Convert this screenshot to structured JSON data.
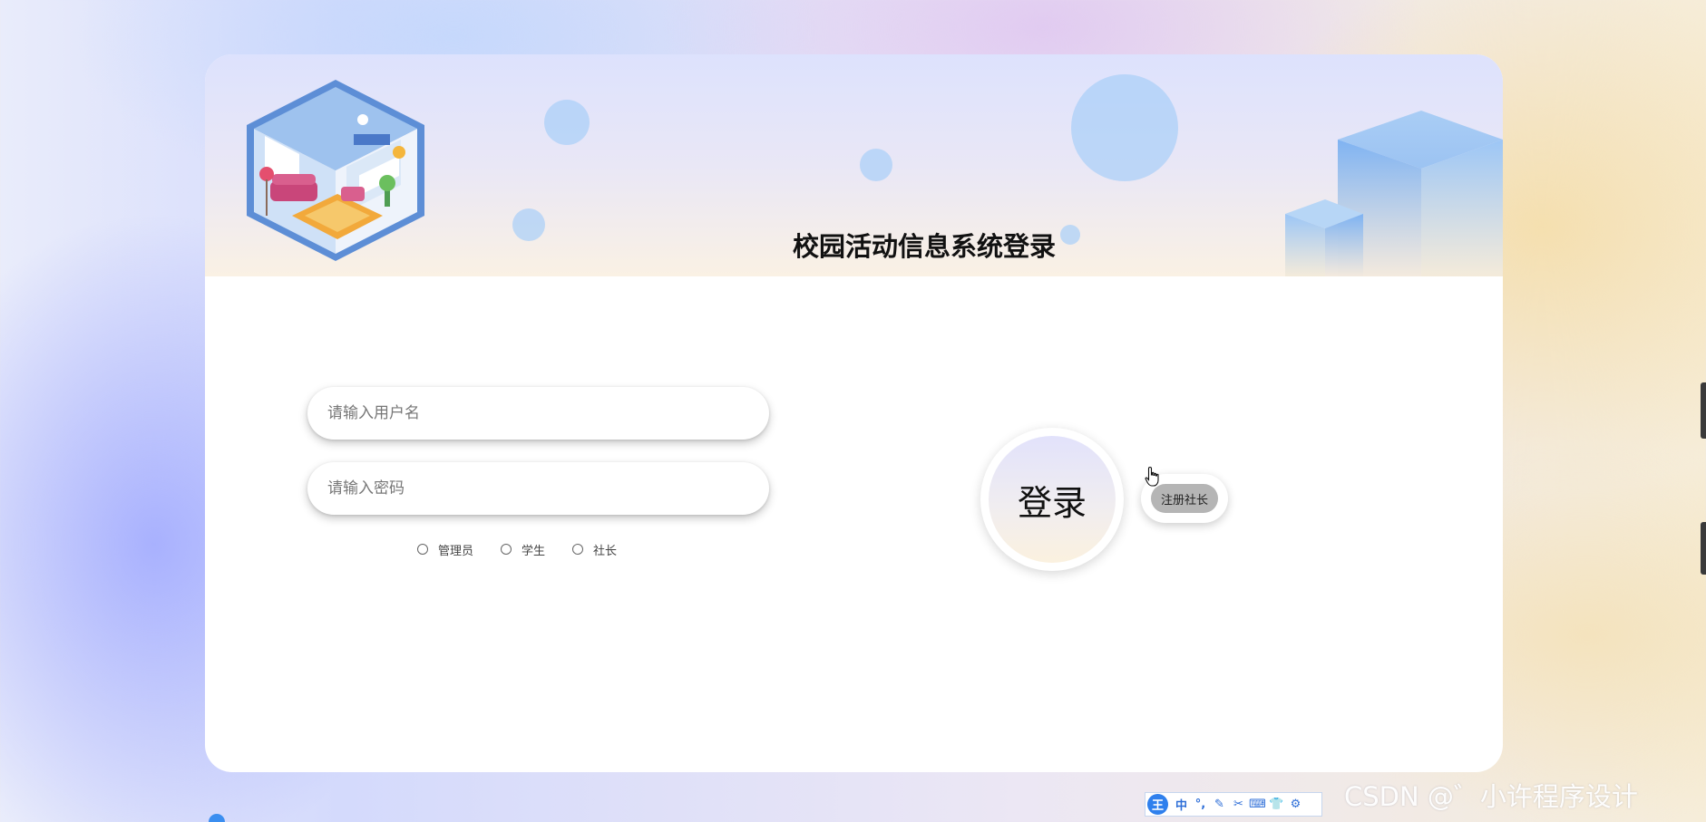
{
  "page": {
    "title": "校园活动信息系统登录"
  },
  "login_form": {
    "username_placeholder": "请输入用户名",
    "password_placeholder": "请输入密码",
    "roles": [
      {
        "label": "管理员"
      },
      {
        "label": "学生"
      },
      {
        "label": "社长"
      }
    ],
    "login_label": "登录",
    "register_label": "注册社长"
  },
  "ime_toolbar": {
    "logo": "王",
    "items": [
      "中",
      "°,",
      "✎",
      "✂",
      "⌨",
      "👕",
      "⚙"
    ]
  },
  "watermark": "CSDN @゛小许程序设计",
  "colors": {
    "accent_blue": "#2f80ed",
    "register_pill": "#b5b5b5"
  }
}
